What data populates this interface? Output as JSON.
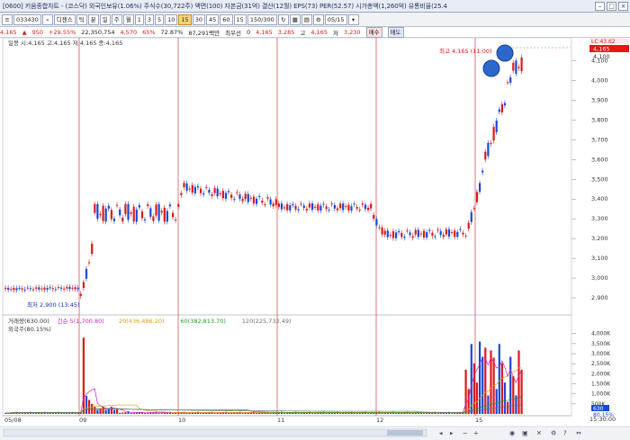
{
  "title_text": "[0600] 키움종합차트 - (코스닥) 외국인보유(1.06%) 주식수(30,722주) 액면(100) 자본금(31억) 결산(12월) EPS(73) PER(52.57) 시가총액(1,260억) 유통비율(25.4",
  "window_buttons": [
    "–",
    "□",
    "×"
  ],
  "toolbar": {
    "stock_code": "033430",
    "stock_name": "디젠스",
    "intervals": [
      "틱",
      "분",
      "일",
      "주",
      "월",
      "1",
      "3",
      "5",
      "10",
      "15",
      "30",
      "45",
      "60"
    ],
    "selected_interval": "15",
    "count_value": "15",
    "count_total": "150/300",
    "date": "05/15"
  },
  "pricebar": {
    "price": "4,165",
    "change": "950",
    "change_pct": "+29.55%",
    "volume": "22,350,754",
    "high": "4,570",
    "high_pct": "65%",
    "turnover": "72.87%",
    "amount": "87,291백만",
    "shares_label": "최우선",
    "shares_val": "0",
    "ohlc": [
      "4,165",
      "3,285",
      "고",
      "4,165",
      "저",
      "3,230"
    ],
    "buy_label": "매수",
    "sell_label": "매도"
  },
  "price_panel": {
    "legend": "일봉 시:4,165 고:4,165 저:4,165 종:4,165",
    "high_annotation": "최고 4,165 (11:00)",
    "low_annotation": "최저 2,900 (13:45)",
    "y_labels": [
      "4,100",
      "4,000",
      "3,900",
      "3,800",
      "3,700",
      "3,600",
      "3,500",
      "3,400",
      "3,300",
      "3,200",
      "3,100",
      "3,000",
      "2,900"
    ],
    "current_tag_top": "LC 43.62",
    "current_tag": "4,165",
    "current_tag_alt": "4,100"
  },
  "volume_panel": {
    "legend": [
      "거래량(630.00)",
      "간순 5(1,700.80)",
      "20(436,486.20)",
      "60(382,813.70)",
      "120(225,732.49)"
    ],
    "legend2": "외국주(80.15%)",
    "y_labels": [
      "4,000K",
      "3,500K",
      "3,000K",
      "2,500K",
      "2,000K",
      "1,500K",
      "1,000K",
      "500K"
    ],
    "tag1": "630",
    "tag2": "80.15%"
  },
  "x_labels": [
    "05/08",
    "09",
    "10",
    "11",
    "12",
    "15"
  ],
  "time_label": "15:30:00",
  "colors": {
    "up": "#e01818",
    "down": "#1848d8",
    "grid": "#cc2020"
  },
  "chart_data": {
    "type": "candlestick",
    "x": [
      "05/08",
      "09",
      "10",
      "11",
      "12",
      "15"
    ],
    "ylim": [
      2850,
      4180
    ],
    "highlights": [
      "circle at price high",
      "circle at price high"
    ]
  }
}
